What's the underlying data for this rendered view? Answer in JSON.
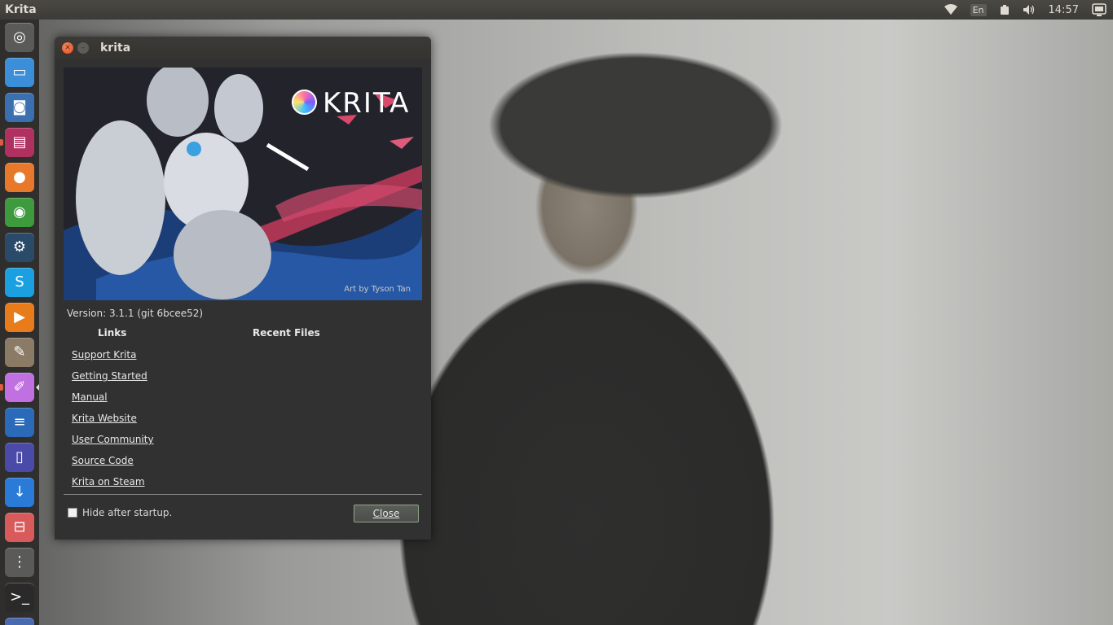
{
  "top_panel": {
    "app_title": "Krita",
    "language": "En",
    "clock": "14:57",
    "icons": [
      "wifi-icon",
      "keyboard-layout",
      "battery-icon",
      "volume-icon",
      "session-icon"
    ]
  },
  "launcher": {
    "items": [
      {
        "name": "ubuntu-dash-icon",
        "color": "#5a5a58"
      },
      {
        "name": "files-window-icon",
        "color": "#3a8fd8"
      },
      {
        "name": "screenshot-icon",
        "color": "#3a6fb0"
      },
      {
        "name": "folder-icon",
        "color": "#b03060"
      },
      {
        "name": "firefox-icon",
        "color": "#e8792a"
      },
      {
        "name": "chrome-icon",
        "color": "#3d9a3d"
      },
      {
        "name": "steam-icon",
        "color": "#2a4a6a"
      },
      {
        "name": "skype-icon",
        "color": "#1aa0e0"
      },
      {
        "name": "vlc-icon",
        "color": "#e87b1a"
      },
      {
        "name": "gimp-icon",
        "color": "#8a7a66"
      },
      {
        "name": "krita-icon",
        "color": "#c070e0"
      },
      {
        "name": "text-editor-icon",
        "color": "#2a6ab8"
      },
      {
        "name": "document-viewer-icon",
        "color": "#4a4aa8"
      },
      {
        "name": "download-icon",
        "color": "#2a7ad8"
      },
      {
        "name": "settings-toggle-icon",
        "color": "#d85a5a"
      },
      {
        "name": "mixer-icon",
        "color": "#5a5a58"
      },
      {
        "name": "terminal-icon",
        "color": "#2a2a2a"
      },
      {
        "name": "trash-icon",
        "color": "#4a6ab0"
      }
    ]
  },
  "window": {
    "title": "krita",
    "splash": {
      "brand": "KRITA",
      "credit": "Art by Tyson Tan"
    },
    "version": "Version: 3.1.1 (git 6bcee52)",
    "links_header": "Links",
    "recent_header": "Recent Files",
    "links": [
      "Support Krita",
      "Getting Started",
      "Manual",
      "Krita Website",
      "User Community",
      "Source Code",
      "Krita on Steam"
    ],
    "hide_after_startup": "Hide after startup.",
    "hide_checked": false,
    "close_label": "Close"
  }
}
